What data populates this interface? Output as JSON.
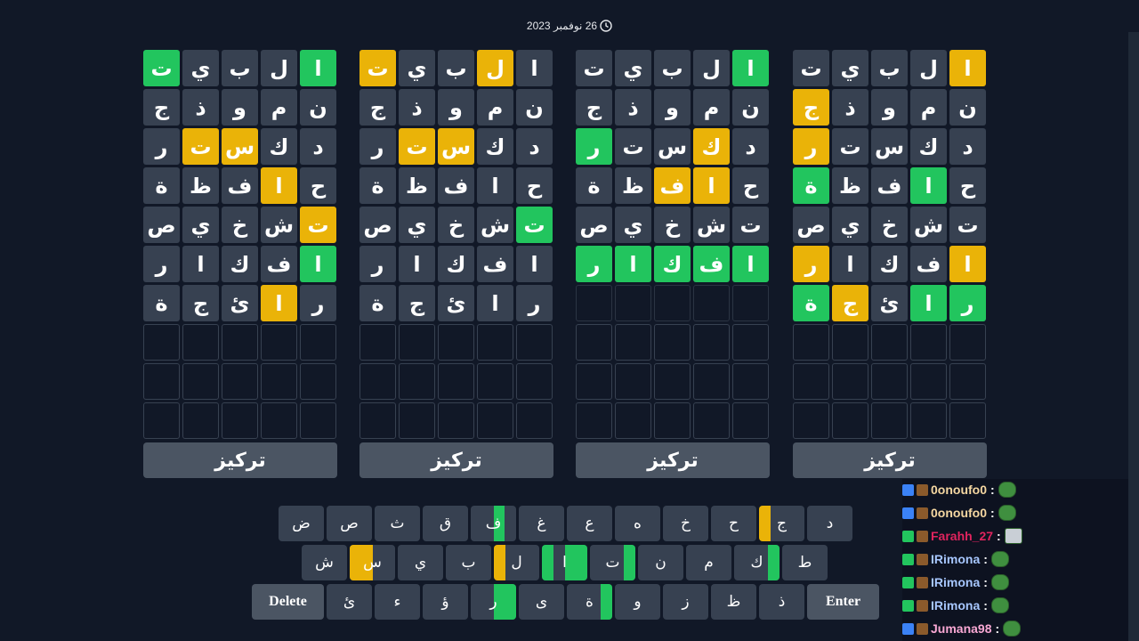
{
  "date": {
    "text": "26 نوفمبر 2023"
  },
  "boards": [
    {
      "focus_label": "تركيز",
      "rows": [
        [
          [
            "ا",
            "green"
          ],
          [
            "ل",
            "filled"
          ],
          [
            "ب",
            "filled"
          ],
          [
            "ي",
            "filled"
          ],
          [
            "ت",
            "green"
          ]
        ],
        [
          [
            "ن",
            "filled"
          ],
          [
            "م",
            "filled"
          ],
          [
            "و",
            "filled"
          ],
          [
            "ذ",
            "filled"
          ],
          [
            "ج",
            "filled"
          ]
        ],
        [
          [
            "د",
            "filled"
          ],
          [
            "ك",
            "filled"
          ],
          [
            "س",
            "yellow"
          ],
          [
            "ت",
            "yellow"
          ],
          [
            "ر",
            "filled"
          ]
        ],
        [
          [
            "ح",
            "filled"
          ],
          [
            "ا",
            "yellow"
          ],
          [
            "ف",
            "filled"
          ],
          [
            "ظ",
            "filled"
          ],
          [
            "ة",
            "filled"
          ]
        ],
        [
          [
            "ت",
            "yellow"
          ],
          [
            "ش",
            "filled"
          ],
          [
            "خ",
            "filled"
          ],
          [
            "ي",
            "filled"
          ],
          [
            "ص",
            "filled"
          ]
        ],
        [
          [
            "ا",
            "green"
          ],
          [
            "ف",
            "filled"
          ],
          [
            "ك",
            "filled"
          ],
          [
            "ا",
            "filled"
          ],
          [
            "ر",
            "filled"
          ]
        ],
        [
          [
            "ر",
            "filled"
          ],
          [
            "ا",
            "yellow"
          ],
          [
            "ئ",
            "filled"
          ],
          [
            "ج",
            "filled"
          ],
          [
            "ة",
            "filled"
          ]
        ],
        [
          [
            "",
            "empty"
          ],
          [
            "",
            "empty"
          ],
          [
            "",
            "empty"
          ],
          [
            "",
            "empty"
          ],
          [
            "",
            "empty"
          ]
        ],
        [
          [
            "",
            "empty"
          ],
          [
            "",
            "empty"
          ],
          [
            "",
            "empty"
          ],
          [
            "",
            "empty"
          ],
          [
            "",
            "empty"
          ]
        ],
        [
          [
            "",
            "empty"
          ],
          [
            "",
            "empty"
          ],
          [
            "",
            "empty"
          ],
          [
            "",
            "empty"
          ],
          [
            "",
            "empty"
          ]
        ]
      ]
    },
    {
      "focus_label": "تركيز",
      "rows": [
        [
          [
            "ا",
            "filled"
          ],
          [
            "ل",
            "yellow"
          ],
          [
            "ب",
            "filled"
          ],
          [
            "ي",
            "filled"
          ],
          [
            "ت",
            "yellow"
          ]
        ],
        [
          [
            "ن",
            "filled"
          ],
          [
            "م",
            "filled"
          ],
          [
            "و",
            "filled"
          ],
          [
            "ذ",
            "filled"
          ],
          [
            "ج",
            "filled"
          ]
        ],
        [
          [
            "د",
            "filled"
          ],
          [
            "ك",
            "filled"
          ],
          [
            "س",
            "yellow"
          ],
          [
            "ت",
            "yellow"
          ],
          [
            "ر",
            "filled"
          ]
        ],
        [
          [
            "ح",
            "filled"
          ],
          [
            "ا",
            "filled"
          ],
          [
            "ف",
            "filled"
          ],
          [
            "ظ",
            "filled"
          ],
          [
            "ة",
            "filled"
          ]
        ],
        [
          [
            "ت",
            "green"
          ],
          [
            "ش",
            "filled"
          ],
          [
            "خ",
            "filled"
          ],
          [
            "ي",
            "filled"
          ],
          [
            "ص",
            "filled"
          ]
        ],
        [
          [
            "ا",
            "filled"
          ],
          [
            "ف",
            "filled"
          ],
          [
            "ك",
            "filled"
          ],
          [
            "ا",
            "filled"
          ],
          [
            "ر",
            "filled"
          ]
        ],
        [
          [
            "ر",
            "filled"
          ],
          [
            "ا",
            "filled"
          ],
          [
            "ئ",
            "filled"
          ],
          [
            "ج",
            "filled"
          ],
          [
            "ة",
            "filled"
          ]
        ],
        [
          [
            "",
            "empty"
          ],
          [
            "",
            "empty"
          ],
          [
            "",
            "empty"
          ],
          [
            "",
            "empty"
          ],
          [
            "",
            "empty"
          ]
        ],
        [
          [
            "",
            "empty"
          ],
          [
            "",
            "empty"
          ],
          [
            "",
            "empty"
          ],
          [
            "",
            "empty"
          ],
          [
            "",
            "empty"
          ]
        ],
        [
          [
            "",
            "empty"
          ],
          [
            "",
            "empty"
          ],
          [
            "",
            "empty"
          ],
          [
            "",
            "empty"
          ],
          [
            "",
            "empty"
          ]
        ]
      ]
    },
    {
      "focus_label": "تركيز",
      "rows": [
        [
          [
            "ا",
            "green"
          ],
          [
            "ل",
            "filled"
          ],
          [
            "ب",
            "filled"
          ],
          [
            "ي",
            "filled"
          ],
          [
            "ت",
            "filled"
          ]
        ],
        [
          [
            "ن",
            "filled"
          ],
          [
            "م",
            "filled"
          ],
          [
            "و",
            "filled"
          ],
          [
            "ذ",
            "filled"
          ],
          [
            "ج",
            "filled"
          ]
        ],
        [
          [
            "د",
            "filled"
          ],
          [
            "ك",
            "yellow"
          ],
          [
            "س",
            "filled"
          ],
          [
            "ت",
            "filled"
          ],
          [
            "ر",
            "green"
          ]
        ],
        [
          [
            "ح",
            "filled"
          ],
          [
            "ا",
            "yellow"
          ],
          [
            "ف",
            "yellow"
          ],
          [
            "ظ",
            "filled"
          ],
          [
            "ة",
            "filled"
          ]
        ],
        [
          [
            "ت",
            "filled"
          ],
          [
            "ش",
            "filled"
          ],
          [
            "خ",
            "filled"
          ],
          [
            "ي",
            "filled"
          ],
          [
            "ص",
            "filled"
          ]
        ],
        [
          [
            "ا",
            "green"
          ],
          [
            "ف",
            "green"
          ],
          [
            "ك",
            "green"
          ],
          [
            "ا",
            "green"
          ],
          [
            "ر",
            "green"
          ]
        ],
        [
          [
            "",
            "blank"
          ],
          [
            "",
            "blank"
          ],
          [
            "",
            "blank"
          ],
          [
            "",
            "blank"
          ],
          [
            "",
            "blank"
          ]
        ],
        [
          [
            "",
            "empty"
          ],
          [
            "",
            "empty"
          ],
          [
            "",
            "empty"
          ],
          [
            "",
            "empty"
          ],
          [
            "",
            "empty"
          ]
        ],
        [
          [
            "",
            "empty"
          ],
          [
            "",
            "empty"
          ],
          [
            "",
            "empty"
          ],
          [
            "",
            "empty"
          ],
          [
            "",
            "empty"
          ]
        ],
        [
          [
            "",
            "empty"
          ],
          [
            "",
            "empty"
          ],
          [
            "",
            "empty"
          ],
          [
            "",
            "empty"
          ],
          [
            "",
            "empty"
          ]
        ]
      ]
    },
    {
      "focus_label": "تركيز",
      "rows": [
        [
          [
            "ا",
            "yellow"
          ],
          [
            "ل",
            "filled"
          ],
          [
            "ب",
            "filled"
          ],
          [
            "ي",
            "filled"
          ],
          [
            "ت",
            "filled"
          ]
        ],
        [
          [
            "ن",
            "filled"
          ],
          [
            "م",
            "filled"
          ],
          [
            "و",
            "filled"
          ],
          [
            "ذ",
            "filled"
          ],
          [
            "ج",
            "yellow"
          ]
        ],
        [
          [
            "د",
            "filled"
          ],
          [
            "ك",
            "filled"
          ],
          [
            "س",
            "filled"
          ],
          [
            "ت",
            "filled"
          ],
          [
            "ر",
            "yellow"
          ]
        ],
        [
          [
            "ح",
            "filled"
          ],
          [
            "ا",
            "green"
          ],
          [
            "ف",
            "filled"
          ],
          [
            "ظ",
            "filled"
          ],
          [
            "ة",
            "green"
          ]
        ],
        [
          [
            "ت",
            "filled"
          ],
          [
            "ش",
            "filled"
          ],
          [
            "خ",
            "filled"
          ],
          [
            "ي",
            "filled"
          ],
          [
            "ص",
            "filled"
          ]
        ],
        [
          [
            "ا",
            "yellow"
          ],
          [
            "ف",
            "filled"
          ],
          [
            "ك",
            "filled"
          ],
          [
            "ا",
            "filled"
          ],
          [
            "ر",
            "yellow"
          ]
        ],
        [
          [
            "ر",
            "green"
          ],
          [
            "ا",
            "green"
          ],
          [
            "ئ",
            "filled"
          ],
          [
            "ج",
            "yellow"
          ],
          [
            "ة",
            "green"
          ]
        ],
        [
          [
            "",
            "empty"
          ],
          [
            "",
            "empty"
          ],
          [
            "",
            "empty"
          ],
          [
            "",
            "empty"
          ],
          [
            "",
            "empty"
          ]
        ],
        [
          [
            "",
            "empty"
          ],
          [
            "",
            "empty"
          ],
          [
            "",
            "empty"
          ],
          [
            "",
            "empty"
          ],
          [
            "",
            "empty"
          ]
        ],
        [
          [
            "",
            "empty"
          ],
          [
            "",
            "empty"
          ],
          [
            "",
            "empty"
          ],
          [
            "",
            "empty"
          ],
          [
            "",
            "empty"
          ]
        ]
      ]
    }
  ],
  "keyboard": {
    "rows": [
      [
        {
          "k": "د",
          "marks": []
        },
        {
          "k": "ج",
          "marks": [
            "none",
            "none",
            "none",
            "yellow"
          ]
        },
        {
          "k": "ح",
          "marks": []
        },
        {
          "k": "خ",
          "marks": []
        },
        {
          "k": "ه",
          "marks": []
        },
        {
          "k": "ع",
          "marks": []
        },
        {
          "k": "غ",
          "marks": []
        },
        {
          "k": "ف",
          "marks": [
            "none",
            "green",
            "none",
            "none"
          ]
        },
        {
          "k": "ق",
          "marks": []
        },
        {
          "k": "ث",
          "marks": []
        },
        {
          "k": "ص",
          "marks": []
        },
        {
          "k": "ض",
          "marks": []
        }
      ],
      [
        {
          "k": "ط",
          "marks": []
        },
        {
          "k": "ك",
          "marks": [
            "green",
            "none",
            "none",
            "none"
          ]
        },
        {
          "k": "م",
          "marks": []
        },
        {
          "k": "ن",
          "marks": []
        },
        {
          "k": "ت",
          "marks": [
            "green",
            "none",
            "none",
            "none"
          ]
        },
        {
          "k": "ا",
          "marks": [
            "green",
            "green",
            "none",
            "green"
          ]
        },
        {
          "k": "ل",
          "marks": [
            "none",
            "none",
            "none",
            "yellow"
          ]
        },
        {
          "k": "ب",
          "marks": []
        },
        {
          "k": "ي",
          "marks": []
        },
        {
          "k": "س",
          "marks": [
            "none",
            "none",
            "yellow",
            "yellow"
          ]
        },
        {
          "k": "ش",
          "marks": []
        }
      ],
      [
        {
          "k": "Enter",
          "wide": true,
          "marks": []
        },
        {
          "k": "ذ",
          "marks": []
        },
        {
          "k": "ظ",
          "marks": []
        },
        {
          "k": "ز",
          "marks": []
        },
        {
          "k": "و",
          "marks": []
        },
        {
          "k": "ة",
          "marks": [
            "green",
            "none",
            "none",
            "none"
          ]
        },
        {
          "k": "ى",
          "marks": []
        },
        {
          "k": "ر",
          "marks": [
            "green",
            "green",
            "none",
            "none"
          ]
        },
        {
          "k": "ؤ",
          "marks": []
        },
        {
          "k": "ء",
          "marks": []
        },
        {
          "k": "ئ",
          "marks": []
        },
        {
          "k": "Delete",
          "wide": true,
          "marks": []
        }
      ]
    ]
  },
  "chat": [
    {
      "user": "0onoufo0",
      "sep": ":",
      "color": "#f5d7a1",
      "badge": "#3b82f6",
      "emote": "pepe"
    },
    {
      "user": "0onoufo0",
      "sep": ":",
      "color": "#f5d7a1",
      "badge": "#3b82f6",
      "emote": "pepe"
    },
    {
      "user": "Farahh_27",
      "sep": ":",
      "color": "#e0245e",
      "badge": "#22c55e",
      "emote": "pic"
    },
    {
      "user": "IRimona",
      "sep": ":",
      "color": "#a7c7ff",
      "badge": "#22c55e",
      "emote": "pepe"
    },
    {
      "user": "IRimona",
      "sep": ":",
      "color": "#a7c7ff",
      "badge": "#22c55e",
      "emote": "pepe"
    },
    {
      "user": "IRimona",
      "sep": ":",
      "color": "#a7c7ff",
      "badge": "#22c55e",
      "emote": "pepe"
    },
    {
      "user": "Jumana98",
      "sep": ":",
      "color": "#f9a8d4",
      "badge": "#3b82f6",
      "emote": "pepe"
    }
  ],
  "colors": {
    "green": "#22c55e",
    "yellow": "#eab308",
    "tile": "#374151",
    "background": "#111827"
  }
}
